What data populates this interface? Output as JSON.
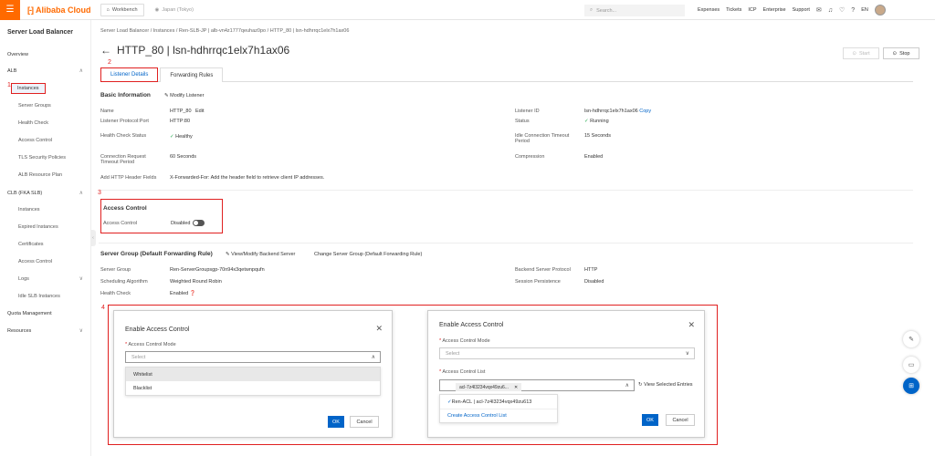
{
  "topbar": {
    "logo_mark": "[-]",
    "logo_text": "Alibaba Cloud",
    "workbench": "Workbench",
    "region": "Japan (Tokyo)",
    "search_placeholder": "Search...",
    "nav": [
      "Expenses",
      "Tickets",
      "ICP",
      "Enterprise",
      "Support"
    ],
    "lang": "EN"
  },
  "sidebar": {
    "title": "Server Load Balancer",
    "overview": "Overview",
    "alb": "ALB",
    "alb_items": [
      "Instances",
      "Server Groups",
      "Health Check",
      "Access Control",
      "TLS Security Policies",
      "ALB Resource Plan"
    ],
    "clb": "CLB (FKA SLB)",
    "clb_items": [
      "Instances",
      "Expired Instances",
      "Certificates",
      "Access Control",
      "Logs",
      "Idle SLB Instances"
    ],
    "quota": "Quota Management",
    "resources": "Resources"
  },
  "annotations": {
    "n1": "1",
    "n2": "2",
    "n3": "3",
    "n4": "4"
  },
  "breadcrumb": "Server Load Balancer  /  Instances  /  Ren-SLB-JP | alb-vn4z1777qeuhaz0po  /  HTTP_80 | lsn-hdhrrqc1elx7h1ax06",
  "page": {
    "title": "HTTP_80 | lsn-hdhrrqc1elx7h1ax06",
    "start": "Start",
    "stop": "Stop",
    "tabs": [
      "Listener Details",
      "Forwarding Rules"
    ]
  },
  "basic": {
    "title": "Basic Information",
    "modify": "Modify Listener",
    "name_l": "Name",
    "name_v": "HTTP_80",
    "edit": "Edit",
    "proto_l": "Listener Protocol:Port",
    "proto_v": "HTTP:80",
    "health_l": "Health Check Status",
    "health_v": "Healthy",
    "timeout_l1": "Connection Request",
    "timeout_l2": "Timeout Period",
    "timeout_v": "60 Seconds",
    "header_l": "Add HTTP Header Fields",
    "header_v": "X-Forwarded-For: Add the header field to retrieve client IP addresses.",
    "id_l": "Listener ID",
    "id_v": "lsn-hdhrrqc1elx7h1ax06",
    "copy": "Copy",
    "status_l": "Status",
    "status_v": "Running",
    "idle_l1": "Idle Connection Timeout",
    "idle_l2": "Period",
    "idle_v": "15 Seconds",
    "comp_l": "Compression",
    "comp_v": "Enabled"
  },
  "access": {
    "title": "Access Control",
    "label": "Access Control",
    "value": "Disabled"
  },
  "server_group": {
    "title": "Server Group (Default Forwarding Rule)",
    "view_modify": "View/Modify Backend Server",
    "change": "Change Server Group (Default Forwarding Rule)",
    "sg_l": "Server Group",
    "sg_v": "Ren-ServerGroupsgp-70n94x3qetwnpqufn",
    "algo_l": "Scheduling Algorithm",
    "algo_v": "Weighted Round Robin",
    "hc_l": "Health Check",
    "hc_v": "Enabled",
    "bp_l": "Backend Server Protocol",
    "bp_v": "HTTP",
    "sp_l": "Session Persistence",
    "sp_v": "Disabled"
  },
  "modal_left": {
    "title": "Enable Access Control",
    "mode_label": "Access Control Mode",
    "select_placeholder": "Select",
    "options": [
      "Whitelist",
      "Blacklist"
    ],
    "ok": "OK",
    "cancel": "Cancel"
  },
  "modal_right": {
    "title": "Enable Access Control",
    "mode_label": "Access Control Mode",
    "select_placeholder": "Select",
    "list_label": "Access Control List",
    "tag": "acl-7z4l3234vqx49zu6...",
    "view_selected": "View Selected Entries",
    "option": "Ren-ACL | acl-7z4l3234vqx49zu613",
    "create": "Create Access Control List",
    "ok": "OK",
    "cancel": "Cancel"
  }
}
